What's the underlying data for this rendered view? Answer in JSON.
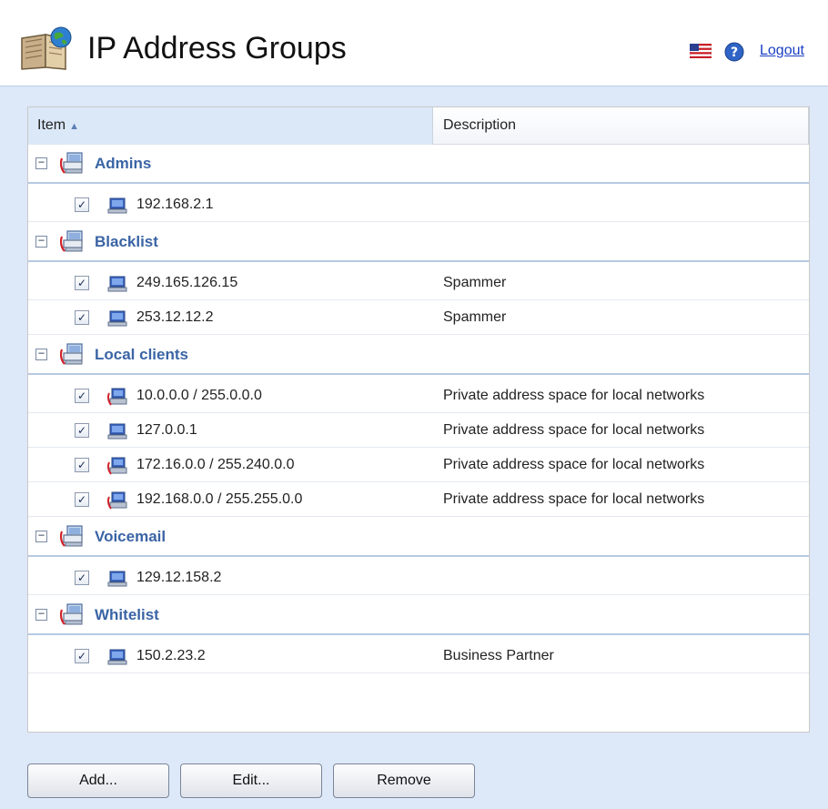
{
  "header": {
    "title": "IP Address Groups",
    "logout_label": "Logout",
    "language_icon": "us-flag-icon",
    "help_icon": "help-icon"
  },
  "table": {
    "columns": {
      "item": "Item",
      "description": "Description"
    },
    "sort": {
      "column": "item",
      "direction": "ascending"
    },
    "groups": [
      {
        "name": "Admins",
        "expanded": true,
        "items": [
          {
            "value": "192.168.2.1",
            "description": "",
            "checked": true,
            "type": "host"
          }
        ]
      },
      {
        "name": "Blacklist",
        "expanded": true,
        "items": [
          {
            "value": "249.165.126.15",
            "description": "Spammer",
            "checked": true,
            "type": "host"
          },
          {
            "value": "253.12.12.2",
            "description": "Spammer",
            "checked": true,
            "type": "host"
          }
        ]
      },
      {
        "name": "Local clients",
        "expanded": true,
        "items": [
          {
            "value": "10.0.0.0 / 255.0.0.0",
            "description": "Private address space for local networks",
            "checked": true,
            "type": "network"
          },
          {
            "value": "127.0.0.1",
            "description": "Private address space for local networks",
            "checked": true,
            "type": "host"
          },
          {
            "value": "172.16.0.0 / 255.240.0.0",
            "description": "Private address space for local networks",
            "checked": true,
            "type": "network"
          },
          {
            "value": "192.168.0.0 / 255.255.0.0",
            "description": "Private address space for local networks",
            "checked": true,
            "type": "network"
          }
        ]
      },
      {
        "name": "Voicemail",
        "expanded": true,
        "items": [
          {
            "value": "129.12.158.2",
            "description": "",
            "checked": true,
            "type": "host"
          }
        ]
      },
      {
        "name": "Whitelist",
        "expanded": true,
        "items": [
          {
            "value": "150.2.23.2",
            "description": "Business Partner",
            "checked": true,
            "type": "host"
          }
        ]
      }
    ]
  },
  "buttons": {
    "add": "Add...",
    "edit": "Edit...",
    "remove": "Remove"
  },
  "colors": {
    "panel": "#dde8f8",
    "group_text": "#3a64a5",
    "link": "#1a3fc4"
  }
}
